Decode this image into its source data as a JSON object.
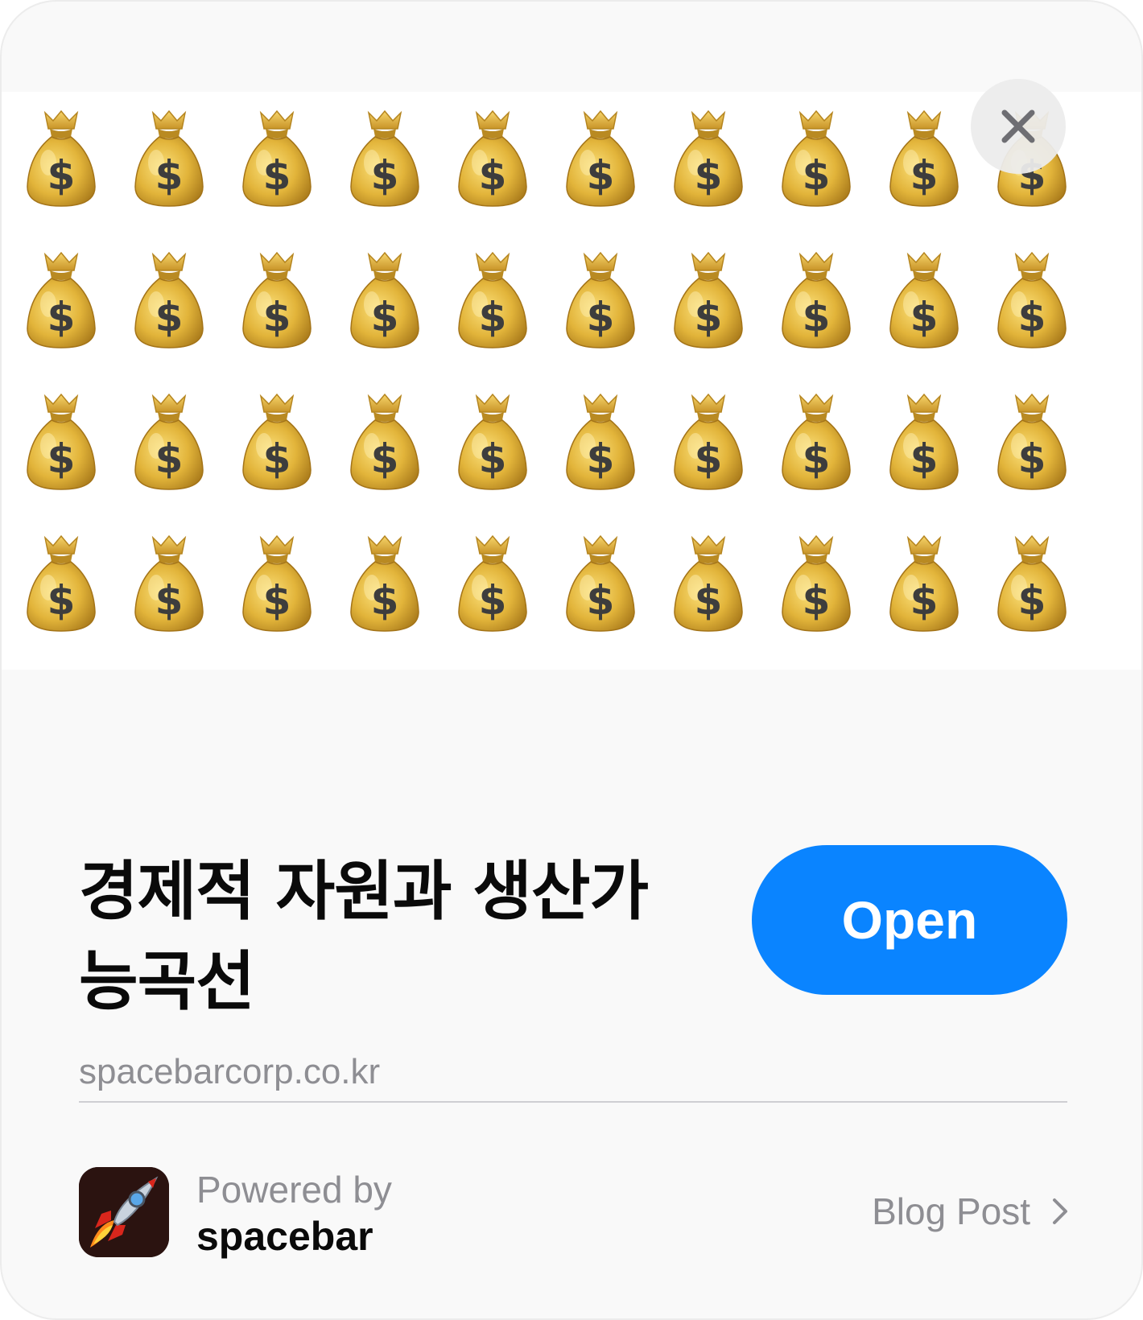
{
  "hero": {
    "emoji": "💰",
    "rows": 4,
    "cols": 10,
    "icon": "money-bag-icon"
  },
  "close": {
    "icon": "close-icon"
  },
  "article": {
    "title_line1": "경제적 자원과 생산가",
    "title_line2": "능곡선",
    "domain": "spacebarcorp.co.kr"
  },
  "actions": {
    "open_label": "Open"
  },
  "footer": {
    "powered_by": "Powered by",
    "brand": "spacebar",
    "app_icon": "rocket-icon",
    "link_label": "Blog Post",
    "link_icon": "chevron-right-icon"
  },
  "colors": {
    "accent": "#0a84ff",
    "secondary_text": "#8e8e93",
    "primary_text": "#0a0a0a",
    "card_background": "#f9f9f9"
  }
}
